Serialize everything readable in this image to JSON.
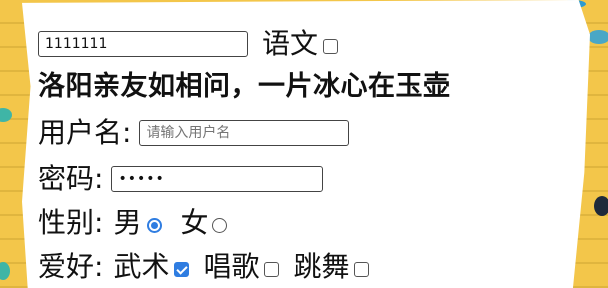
{
  "top": {
    "text_value": "1111111",
    "subject_label": "语文"
  },
  "poem_line": "洛阳亲友如相问，一片冰心在玉壶",
  "form": {
    "username": {
      "label": "用户名:",
      "placeholder": "请输入用户名"
    },
    "password": {
      "label": "密码:",
      "value": "•••••"
    },
    "gender": {
      "label": "性别:",
      "options": [
        "男",
        "女"
      ],
      "selected": "男"
    },
    "hobbies": {
      "label": "爱好:",
      "options": [
        "武术",
        "唱歌",
        "跳舞"
      ],
      "checked": [
        "武术"
      ]
    }
  },
  "colors": {
    "accent": "#2f7de1",
    "background": "#f3c64a"
  }
}
